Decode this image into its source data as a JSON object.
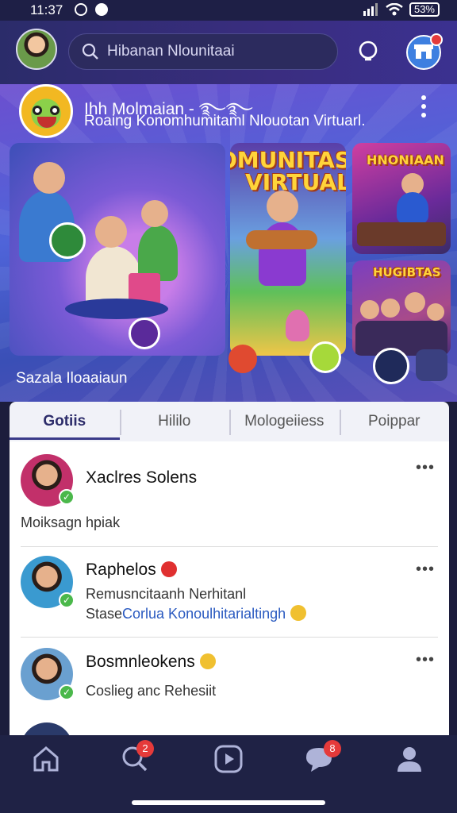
{
  "status_bar": {
    "time": "11:37",
    "battery": "53%"
  },
  "header": {
    "search_text": "Hibanan Nlounitaai"
  },
  "banner": {
    "title": "Ihh Molmaian - ࿐࿐",
    "subtitle": "Roaing Konomhumitaml Nlouotan Virtuarl.",
    "card_title_main": "KOMUNITAS VIRTUAL",
    "card_title_right_top": "HNONIAAN",
    "card_title_right_bottom": "HUGIBTAS",
    "caption": "Sazala Iloaaiaun"
  },
  "tabs": [
    {
      "label": "Gotiis",
      "active": true
    },
    {
      "label": "Hililo",
      "active": false
    },
    {
      "label": "Mologeiiess",
      "active": false
    },
    {
      "label": "Poippar",
      "active": false
    }
  ],
  "posts": [
    {
      "name": "Xaclres Solens",
      "line1": "Moiksagn hpiak",
      "line2": ""
    },
    {
      "name": "Raphelos",
      "line1": "Remusncitaanh Nerhitanl",
      "line2_prefix": "Stase",
      "line2_link": "Corlua Konoulhitarialtingh"
    },
    {
      "name": "Bosmnleokens",
      "line1": "Coslieg anc Rehesiit"
    }
  ],
  "nav": {
    "search_badge": "2",
    "chat_badge": "8"
  },
  "colors": {
    "accent": "#3b3b8a",
    "badge": "#e53a3a",
    "header": "#2b2c6a"
  }
}
